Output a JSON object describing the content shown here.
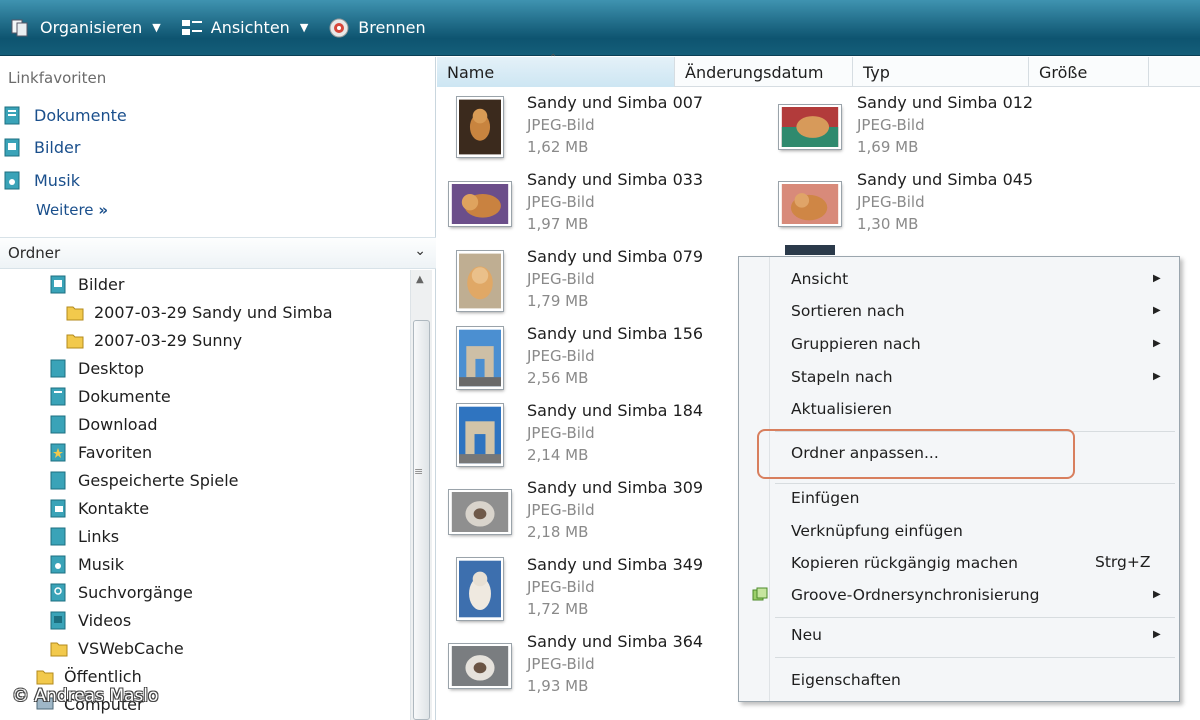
{
  "toolbar": {
    "organize": "Organisieren",
    "views": "Ansichten",
    "burn": "Brennen"
  },
  "favorites": {
    "title": "Linkfavoriten",
    "items": [
      "Dokumente",
      "Bilder",
      "Musik"
    ],
    "more": "Weitere"
  },
  "folders": {
    "header": "Ordner",
    "tree": [
      "Bilder",
      "2007-03-29 Sandy und Simba",
      "2007-03-29 Sunny",
      "Desktop",
      "Dokumente",
      "Download",
      "Favoriten",
      "Gespeicherte Spiele",
      "Kontakte",
      "Links",
      "Musik",
      "Suchvorgänge",
      "Videos",
      "VSWebCache",
      "Öffentlich",
      "Computer"
    ]
  },
  "columns": [
    "Name",
    "Änderungsdatum",
    "Typ",
    "Größe"
  ],
  "files": [
    {
      "name": "Sandy und Simba 007",
      "type": "JPEG-Bild",
      "size": "1,62 MB"
    },
    {
      "name": "Sandy und Simba 012",
      "type": "JPEG-Bild",
      "size": "1,69 MB"
    },
    {
      "name": "Sandy und Simba 033",
      "type": "JPEG-Bild",
      "size": "1,97 MB"
    },
    {
      "name": "Sandy und Simba 045",
      "type": "JPEG-Bild",
      "size": "1,30 MB"
    },
    {
      "name": "Sandy und Simba 079",
      "type": "JPEG-Bild",
      "size": "1,79 MB"
    },
    {
      "name": "Sandy und Simba 156",
      "type": "JPEG-Bild",
      "size": "2,56 MB"
    },
    {
      "name": "Sandy und Simba 184",
      "type": "JPEG-Bild",
      "size": "2,14 MB"
    },
    {
      "name": "Sandy und Simba 309",
      "type": "JPEG-Bild",
      "size": "2,18 MB"
    },
    {
      "name": "Sandy und Simba 349",
      "type": "JPEG-Bild",
      "size": "1,72 MB"
    },
    {
      "name": "Sandy und Simba 364",
      "type": "JPEG-Bild",
      "size": "1,93 MB"
    }
  ],
  "context_menu": {
    "view": "Ansicht",
    "sort_by": "Sortieren nach",
    "group_by": "Gruppieren nach",
    "stack_by": "Stapeln nach",
    "refresh": "Aktualisieren",
    "customize": "Ordner anpassen...",
    "paste": "Einfügen",
    "paste_shortcut": "Verknüpfung einfügen",
    "undo_copy": "Kopieren rückgängig machen",
    "undo_shortcut": "Strg+Z",
    "groove": "Groove-Ordnersynchronisierung",
    "new": "Neu",
    "properties": "Eigenschaften"
  },
  "copyright": "© Andreas Maslo"
}
